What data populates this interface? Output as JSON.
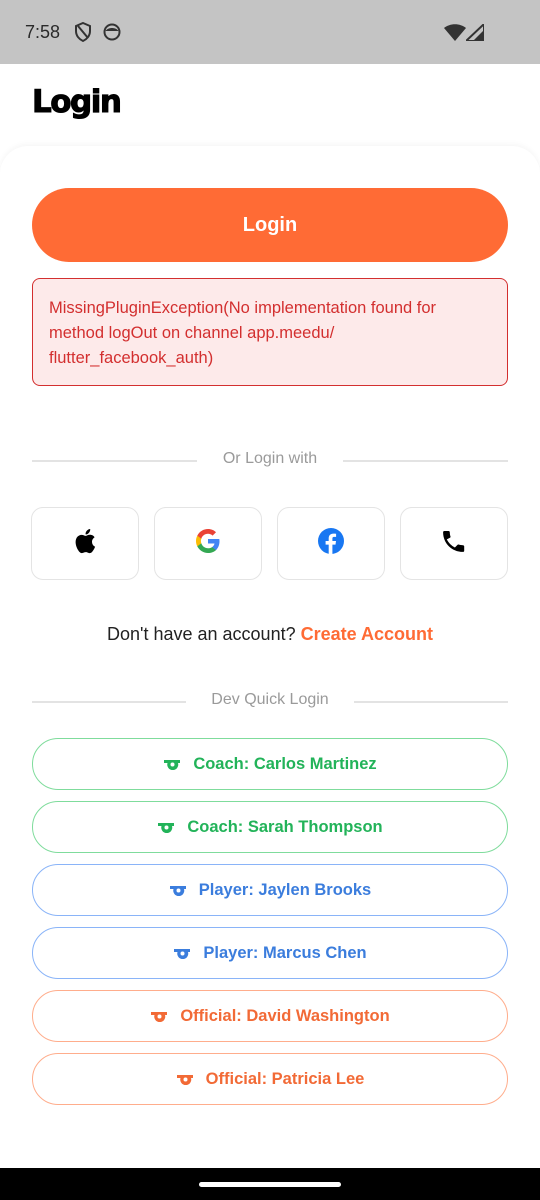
{
  "status_bar": {
    "time": "7:58",
    "icons": [
      "shield-icon",
      "face-icon",
      "wifi-icon",
      "signal-icon"
    ]
  },
  "header": {
    "title": "Login"
  },
  "login_button": {
    "label": "Login",
    "color": "#ff6b35"
  },
  "error": {
    "message": "MissingPluginException(No implementation found for method logOut on channel app.meedu/ flutter_facebook_auth)",
    "color": "#d32f2f",
    "background": "#fdeaea"
  },
  "social_divider": {
    "label": "Or Login with"
  },
  "social_buttons": [
    {
      "name": "apple",
      "icon": "apple-icon"
    },
    {
      "name": "google",
      "icon": "google-icon"
    },
    {
      "name": "facebook",
      "icon": "facebook-icon"
    },
    {
      "name": "phone",
      "icon": "phone-icon"
    }
  ],
  "signup": {
    "prompt": "Don't have an account?",
    "link": "Create Account"
  },
  "dev_divider": {
    "label": "Dev Quick Login"
  },
  "dev_logins": [
    {
      "label": "Coach: Carlos Martinez",
      "role": "coach",
      "icon": "whistle-icon",
      "color": "#22b359"
    },
    {
      "label": "Coach: Sarah Thompson",
      "role": "coach",
      "icon": "whistle-icon",
      "color": "#22b359"
    },
    {
      "label": "Player: Jaylen Brooks",
      "role": "player",
      "icon": "whistle-icon",
      "color": "#3b7ddd"
    },
    {
      "label": "Player: Marcus Chen",
      "role": "player",
      "icon": "whistle-icon",
      "color": "#3b7ddd"
    },
    {
      "label": "Official: David Washington",
      "role": "official",
      "icon": "whistle-icon",
      "color": "#f26a36"
    },
    {
      "label": "Official: Patricia Lee",
      "role": "official",
      "icon": "whistle-icon",
      "color": "#f26a36"
    }
  ]
}
